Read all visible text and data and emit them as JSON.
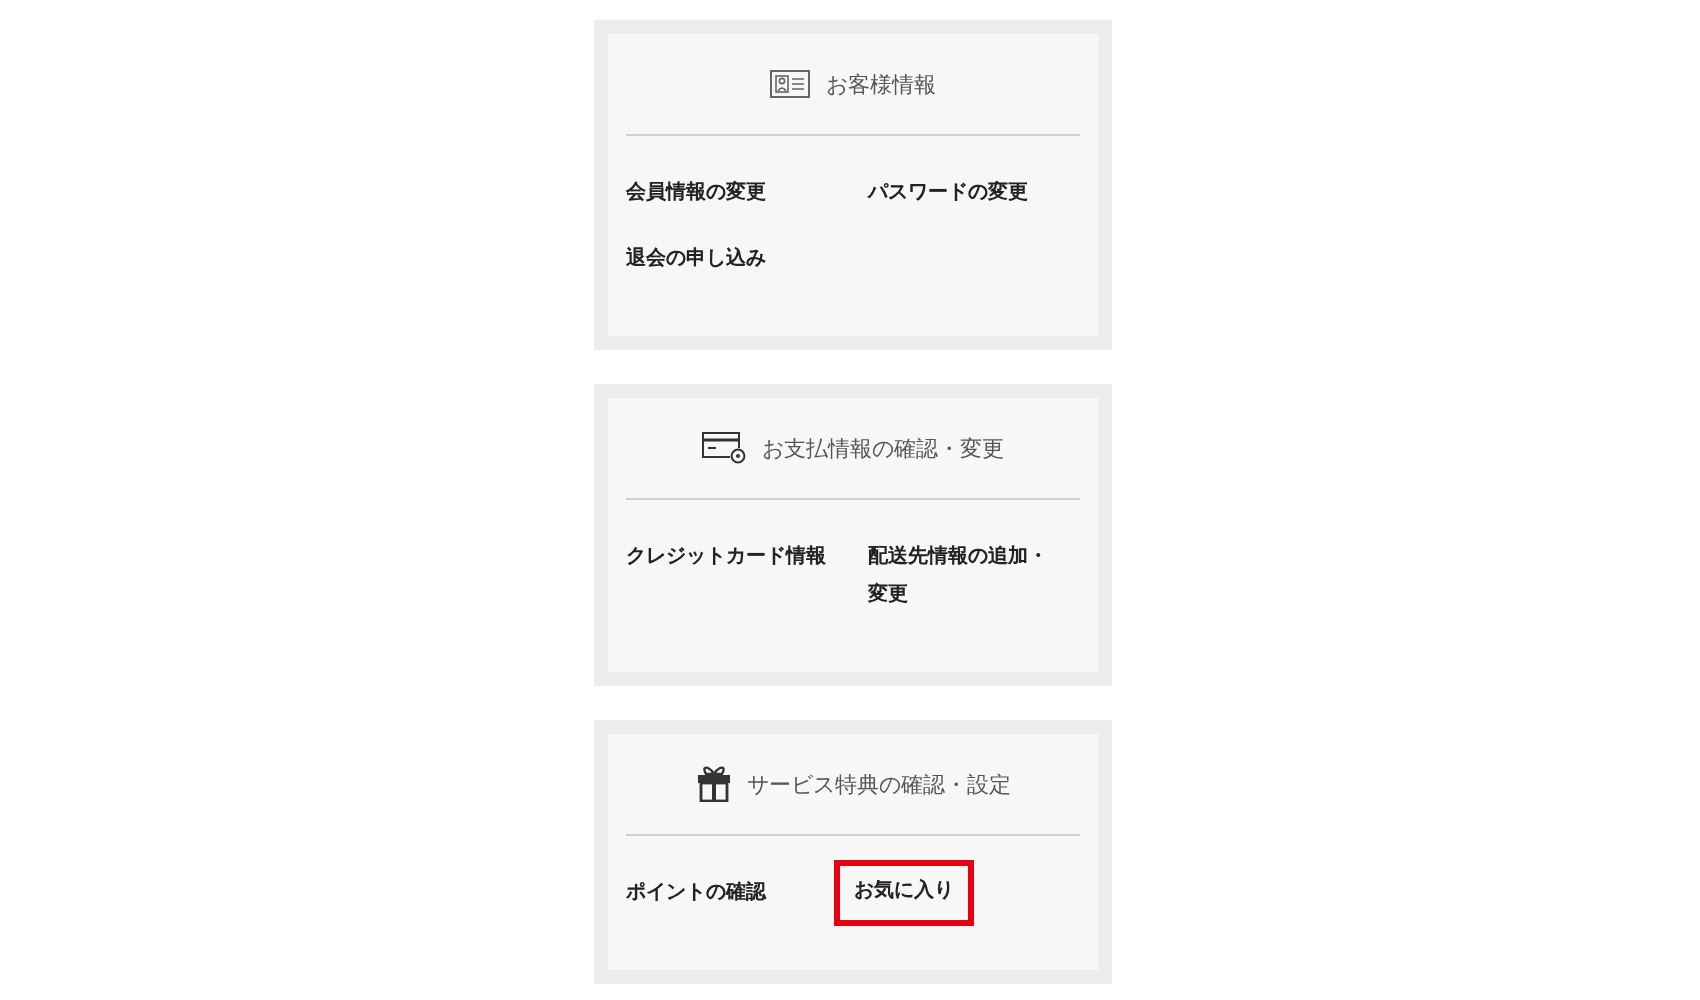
{
  "sections": [
    {
      "kind": "id-card",
      "title": "お客様情報",
      "links": [
        {
          "label": "会員情報の変更",
          "highlighted": false
        },
        {
          "label": "パスワードの変更",
          "highlighted": false
        },
        {
          "label": "退会の申し込み",
          "highlighted": false
        }
      ]
    },
    {
      "kind": "credit-card",
      "title": "お支払情報の確認・変更",
      "links": [
        {
          "label": "クレジットカード情報",
          "highlighted": false
        },
        {
          "label": "配送先情報の追加・変更",
          "highlighted": false
        }
      ]
    },
    {
      "kind": "gift",
      "title": "サービス特典の確認・設定",
      "links": [
        {
          "label": "ポイントの確認",
          "highlighted": false
        },
        {
          "label": "お気に入り",
          "highlighted": true
        }
      ]
    }
  ]
}
